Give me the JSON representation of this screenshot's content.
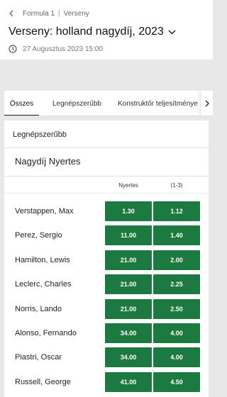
{
  "breadcrumb": {
    "sport": "Formula 1",
    "separator": "|",
    "section": "Verseny"
  },
  "event": {
    "title": "Verseny: holland nagydíj, 2023",
    "datetime": "27 Augusztus 2023 15:00"
  },
  "tabs": [
    {
      "label": "Összes",
      "active": true
    },
    {
      "label": "Legnépszerűbb",
      "active": false
    },
    {
      "label": "Konstruktőr teljesítménye",
      "active": false
    }
  ],
  "section_title": "Legnépszerűbb",
  "market": {
    "title": "Nagydíj Nyertes",
    "columns": [
      "Nyertes",
      "(1-3)"
    ],
    "rows": [
      {
        "name": "Verstappen, Max",
        "odds": [
          "1.30",
          "1.12"
        ]
      },
      {
        "name": "Perez, Sergio",
        "odds": [
          "11.00",
          "1.40"
        ]
      },
      {
        "name": "Hamilton, Lewis",
        "odds": [
          "21.00",
          "2.00"
        ]
      },
      {
        "name": "Leclerc, Charles",
        "odds": [
          "21.00",
          "2.25"
        ]
      },
      {
        "name": "Norris, Lando",
        "odds": [
          "21.00",
          "2.50"
        ]
      },
      {
        "name": "Alonso, Fernando",
        "odds": [
          "34.00",
          "4.00"
        ]
      },
      {
        "name": "Piastri, Oscar",
        "odds": [
          "34.00",
          "4.00"
        ]
      },
      {
        "name": "Russell, George",
        "odds": [
          "41.00",
          "4.50"
        ]
      }
    ]
  },
  "colors": {
    "odds_button": "#1c7a40",
    "page_background": "#e8e8e8"
  },
  "icons": {
    "back": "chevron-left-icon",
    "title_dropdown": "chevron-down-icon",
    "time": "clock-icon",
    "tabs_scroll": "chevron-right-icon"
  }
}
